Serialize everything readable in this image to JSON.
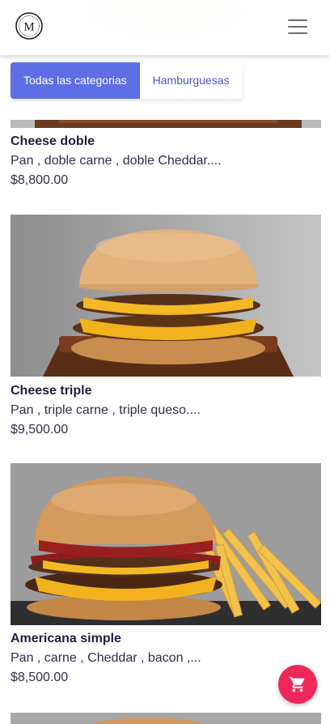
{
  "header": {
    "logo_letter": "M",
    "menu_icon": "hamburger-menu-icon"
  },
  "tabs": [
    {
      "label": "Todas las categorias",
      "active": true
    },
    {
      "label": "Hamburguesas",
      "active": false
    }
  ],
  "products": [
    {
      "name": "Cheese doble",
      "description": "Pan , doble carne , doble Cheddar....",
      "price": "$8,800.00"
    },
    {
      "name": "Cheese triple",
      "description": "Pan , triple carne , triple queso....",
      "price": "$9,500.00"
    },
    {
      "name": "Americana simple",
      "description": "Pan , carne , Cheddar , bacon ,...",
      "price": "$8,500.00"
    }
  ],
  "cart": {
    "icon": "shopping-cart-icon"
  },
  "colors": {
    "accent": "#5e6ee6",
    "cart": "#f0285a"
  }
}
